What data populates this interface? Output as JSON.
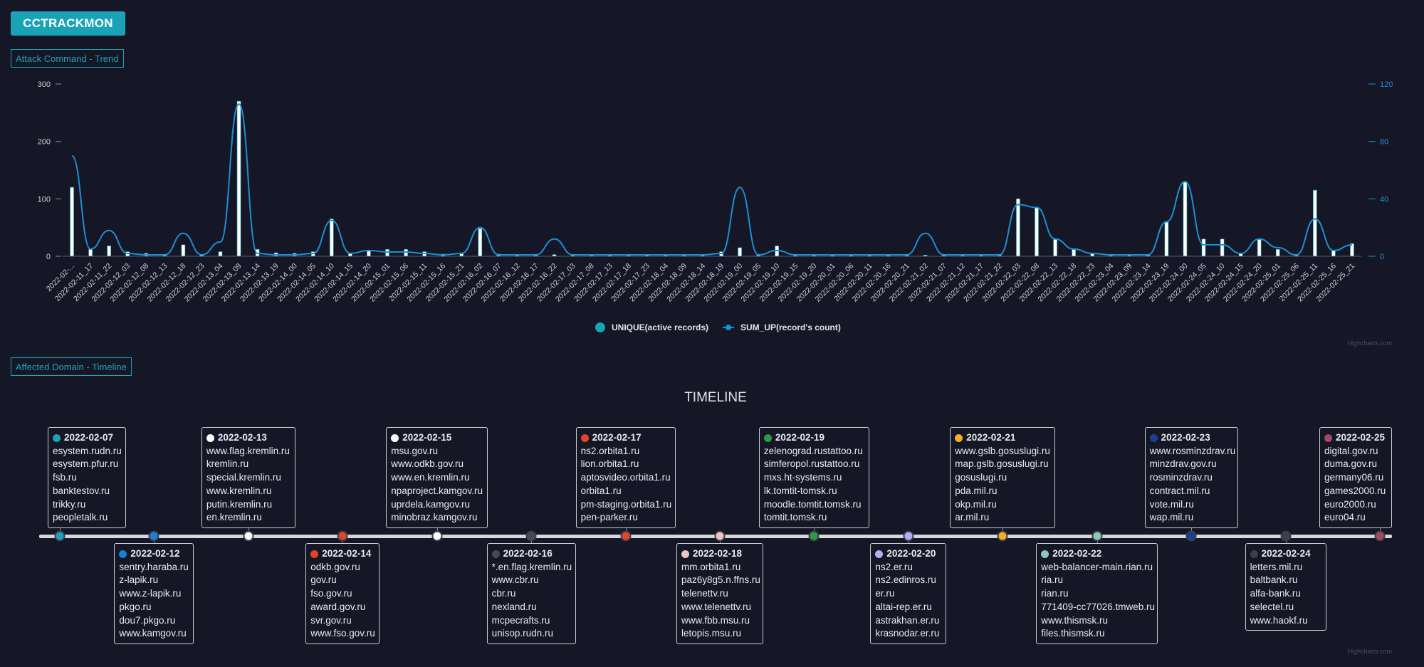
{
  "app": {
    "title": "CCTRACKMON"
  },
  "sections": {
    "trend_label": "Attack Command - Trend",
    "timeline_label": "Affected Domain - Timeline"
  },
  "credits": {
    "chart": "Highcharts.com",
    "timeline": "Highcharts.com"
  },
  "colors": {
    "accent": "#1aa3b7",
    "background": "#161726",
    "unique_bar": "#ffffff",
    "sum_line": "#1b8fd6"
  },
  "chart_data": {
    "type": "bar",
    "title": "",
    "legend_position": "bottom-center",
    "grid": false,
    "y_left": {
      "ticks": [
        0,
        100,
        200,
        300
      ],
      "ylim": [
        0,
        300
      ]
    },
    "y_right": {
      "ticks": [
        0,
        40,
        80,
        120
      ],
      "ylim": [
        0,
        120
      ]
    },
    "categories": [
      "2022-02-...",
      "2022-02-11_17",
      "2022-02-11_22",
      "2022-02-12_03",
      "2022-02-12_08",
      "2022-02-12_13",
      "2022-02-12_18",
      "2022-02-12_23",
      "2022-02-13_04",
      "2022-02-13_09",
      "2022-02-13_14",
      "2022-02-13_19",
      "2022-02-14_00",
      "2022-02-14_05",
      "2022-02-14_10",
      "2022-02-14_15",
      "2022-02-14_20",
      "2022-02-15_01",
      "2022-02-15_06",
      "2022-02-15_11",
      "2022-02-15_16",
      "2022-02-15_21",
      "2022-02-16_02",
      "2022-02-16_07",
      "2022-02-16_12",
      "2022-02-16_17",
      "2022-02-16_22",
      "2022-02-17_03",
      "2022-02-17_08",
      "2022-02-17_13",
      "2022-02-17_18",
      "2022-02-17_23",
      "2022-02-18_04",
      "2022-02-18_09",
      "2022-02-18_14",
      "2022-02-18_19",
      "2022-02-19_00",
      "2022-02-19_05",
      "2022-02-19_10",
      "2022-02-19_15",
      "2022-02-19_20",
      "2022-02-20_01",
      "2022-02-20_06",
      "2022-02-20_11",
      "2022-02-20_16",
      "2022-02-20_21",
      "2022-02-21_02",
      "2022-02-21_07",
      "2022-02-21_12",
      "2022-02-21_17",
      "2022-02-21_22",
      "2022-02-22_03",
      "2022-02-22_08",
      "2022-02-22_13",
      "2022-02-22_18",
      "2022-02-22_23",
      "2022-02-23_04",
      "2022-02-23_09",
      "2022-02-23_14",
      "2022-02-23_19",
      "2022-02-24_00",
      "2022-02-24_05",
      "2022-02-24_10",
      "2022-02-24_15",
      "2022-02-24_20",
      "2022-02-25_01",
      "2022-02-25_06",
      "2022-02-25_11",
      "2022-02-25_16",
      "2022-02-25_21"
    ],
    "series": [
      {
        "name": "UNIQUE(active records)",
        "type": "column",
        "axis": "left",
        "values": [
          120,
          12,
          18,
          8,
          5,
          3,
          20,
          3,
          8,
          270,
          12,
          6,
          5,
          8,
          65,
          6,
          10,
          12,
          12,
          8,
          4,
          6,
          48,
          4,
          3,
          2,
          3,
          2,
          2,
          2,
          2,
          2,
          2,
          2,
          2,
          8,
          15,
          2,
          18,
          2,
          2,
          2,
          2,
          2,
          2,
          2,
          2,
          2,
          2,
          2,
          2,
          100,
          85,
          30,
          12,
          4,
          3,
          2,
          2,
          60,
          130,
          30,
          30,
          5,
          30,
          12,
          2,
          115,
          10,
          22
        ]
      },
      {
        "name": "SUM_UP(record's count)",
        "type": "spline",
        "axis": "right",
        "values": [
          70,
          5,
          18,
          2,
          1,
          1,
          16,
          1,
          10,
          106,
          2,
          1,
          1,
          2,
          25,
          2,
          4,
          3,
          3,
          2,
          1,
          2,
          20,
          1,
          1,
          1,
          12,
          1,
          1,
          1,
          1,
          1,
          1,
          1,
          1,
          2,
          48,
          1,
          4,
          1,
          1,
          1,
          1,
          1,
          1,
          1,
          16,
          1,
          1,
          1,
          1,
          36,
          34,
          12,
          5,
          2,
          1,
          1,
          1,
          24,
          52,
          8,
          8,
          2,
          12,
          6,
          1,
          26,
          4,
          8
        ]
      }
    ]
  },
  "timeline": {
    "title": "TIMELINE",
    "events": [
      {
        "date": "2022-02-07",
        "color": "#1aa3b7",
        "position": "above",
        "domains": [
          "esystem.rudn.ru",
          "esystem.pfur.ru",
          "fsb.ru",
          "banktestov.ru",
          "trikky.ru",
          "peopletalk.ru"
        ]
      },
      {
        "date": "2022-02-12",
        "color": "#1b7fd0",
        "position": "below",
        "domains": [
          "sentry.haraba.ru",
          "z-lapik.ru",
          "www.z-lapik.ru",
          "pkgo.ru",
          "dou7.pkgo.ru",
          "www.kamgov.ru"
        ]
      },
      {
        "date": "2022-02-13",
        "color": "#ffffff",
        "position": "above",
        "domains": [
          "www.flag.kremlin.ru",
          "kremlin.ru",
          "special.kremlin.ru",
          "www.kremlin.ru",
          "putin.kremlin.ru",
          "en.kremlin.ru"
        ]
      },
      {
        "date": "2022-02-14",
        "color": "#e2452b",
        "position": "below",
        "domains": [
          "odkb.gov.ru",
          "gov.ru",
          "fso.gov.ru",
          "award.gov.ru",
          "svr.gov.ru",
          "www.fso.gov.ru"
        ]
      },
      {
        "date": "2022-02-15",
        "color": "#ffffff",
        "position": "above",
        "domains": [
          "msu.gov.ru",
          "www.odkb.gov.ru",
          "www.en.kremlin.ru",
          "npaproject.kamgov.ru",
          "uprdela.kamgov.ru",
          "minobraz.kamgov.ru"
        ]
      },
      {
        "date": "2022-02-16",
        "color": "#454a52",
        "position": "below",
        "domains": [
          "*.en.flag.kremlin.ru",
          "www.cbr.ru",
          "cbr.ru",
          "nexland.ru",
          "mcpecrafts.ru",
          "unisop.rudn.ru"
        ]
      },
      {
        "date": "2022-02-17",
        "color": "#e2452b",
        "position": "above",
        "domains": [
          "ns2.orbita1.ru",
          "lion.orbita1.ru",
          "aptosvideo.orbita1.ru",
          "orbita1.ru",
          "pm-staging.orbita1.ru",
          "pen-parker.ru"
        ]
      },
      {
        "date": "2022-02-18",
        "color": "#f0c4c8",
        "position": "below",
        "domains": [
          "mm.orbita1.ru",
          "paz6y8g5.n.ffns.ru",
          "telenettv.ru",
          "www.telenettv.ru",
          "www.fbb.msu.ru",
          "letopis.msu.ru"
        ]
      },
      {
        "date": "2022-02-19",
        "color": "#2b9a45",
        "position": "above",
        "domains": [
          "zelenograd.rustattoo.ru",
          "simferopol.rustattoo.ru",
          "mxs.ht-systems.ru",
          "lk.tomtit-tomsk.ru",
          "moodle.tomtit.tomsk.ru",
          "tomtit.tomsk.ru"
        ]
      },
      {
        "date": "2022-02-20",
        "color": "#b4aef0",
        "position": "below",
        "domains": [
          "ns2.er.ru",
          "ns2.edinros.ru",
          "er.ru",
          "altai-rep.er.ru",
          "astrakhan.er.ru",
          "krasnodar.er.ru"
        ]
      },
      {
        "date": "2022-02-21",
        "color": "#f0b020",
        "position": "above",
        "domains": [
          "www.gslb.gosuslugi.ru",
          "map.gslb.gosuslugi.ru",
          "gosuslugi.ru",
          "pda.mil.ru",
          "okp.mil.ru",
          "ar.mil.ru"
        ]
      },
      {
        "date": "2022-02-22",
        "color": "#8fc7b6",
        "position": "below",
        "domains": [
          "web-balancer-main.rian.ru",
          "ria.ru",
          "rian.ru",
          "771409-cc77026.tmweb.ru",
          "www.thismsk.ru",
          "files.thismsk.ru"
        ]
      },
      {
        "date": "2022-02-23",
        "color": "#1a3f8f",
        "position": "above",
        "domains": [
          "www.rosminzdrav.ru",
          "minzdrav.gov.ru",
          "rosminzdrav.ru",
          "contract.mil.ru",
          "vote.mil.ru",
          "wap.mil.ru"
        ]
      },
      {
        "date": "2022-02-24",
        "color": "#3c3e48",
        "position": "below",
        "domains": [
          "letters.mil.ru",
          "baltbank.ru",
          "alfa-bank.ru",
          "selectel.ru",
          "www.haokf.ru"
        ]
      },
      {
        "date": "2022-02-25",
        "color": "#a04a62",
        "position": "above",
        "domains": [
          "digital.gov.ru",
          "duma.gov.ru",
          "germany06.ru",
          "games2000.ru",
          "euro2000.ru",
          "euro04.ru"
        ]
      }
    ]
  }
}
